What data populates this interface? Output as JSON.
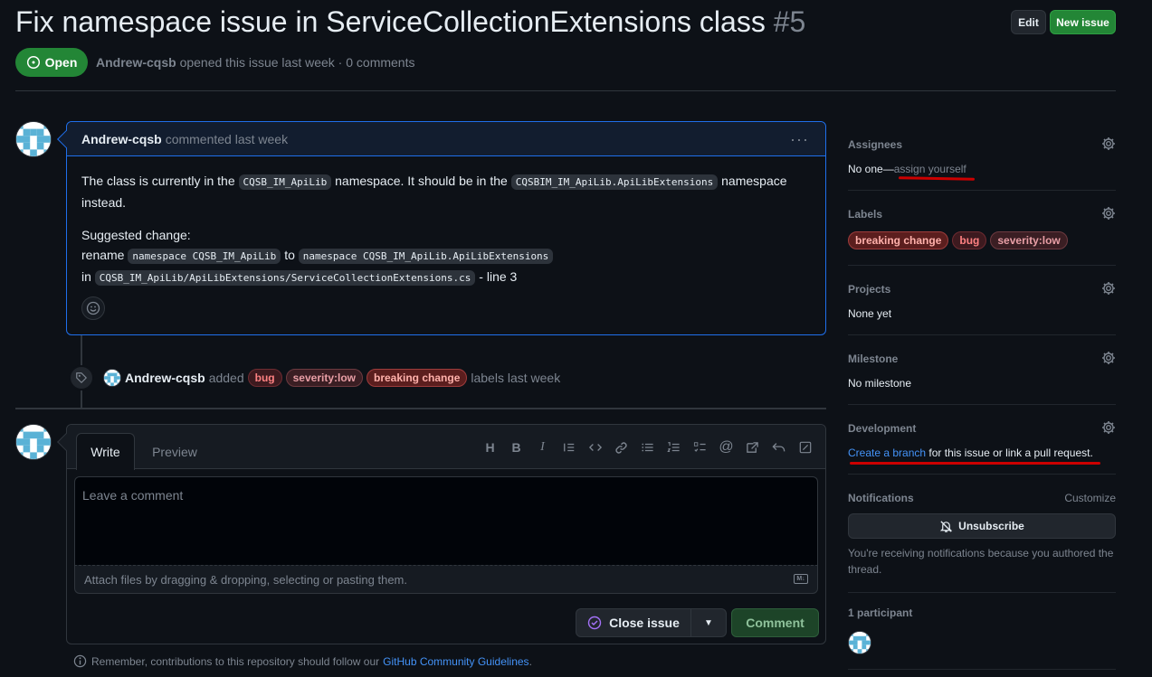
{
  "issue": {
    "title": "Fix namespace issue in ServiceCollectionExtensions class",
    "number": "#5",
    "state": "Open",
    "author": "Andrew-cqsb",
    "meta_text": "opened this issue last week · 0 comments"
  },
  "header": {
    "edit_label": "Edit",
    "new_issue_label": "New issue"
  },
  "comment": {
    "author": "Andrew-cqsb",
    "time_text": "commented last week",
    "menu": "···",
    "p1_a": "The class is currently in the",
    "p1_code1": "CQSB_IM_ApiLib",
    "p1_b": "namespace. It should be in the",
    "p1_code2": "CQSBIM_IM_ApiLib.ApiLibExtensions",
    "p1_c": "namespace instead.",
    "p2_title": "Suggested change:",
    "p2_rename": "rename",
    "p2_code1": "namespace CQSB_IM_ApiLib",
    "p2_to": "to",
    "p2_code2": "namespace CQSB_IM_ApiLib.ApiLibExtensions",
    "p2_in": "in",
    "p2_code3": "CQSB_IM_ApiLib/ApiLibExtensions/ServiceCollectionExtensions.cs",
    "p2_line": "- line 3"
  },
  "event": {
    "author": "Andrew-cqsb",
    "added": "added",
    "labels": [
      "bug",
      "severity:low",
      "breaking change"
    ],
    "suffix": "labels last week"
  },
  "composer": {
    "tab_write": "Write",
    "tab_preview": "Preview",
    "placeholder": "Leave a comment",
    "attach_text": "Attach files by dragging & dropping, selecting or pasting them.",
    "md_badge": "M↓",
    "close_label": "Close issue",
    "comment_label": "Comment",
    "toolbar_icons": [
      "heading-icon",
      "bold-icon",
      "italic-icon",
      "quote-icon",
      "code-icon",
      "link-icon",
      "bulleted-list-icon",
      "numbered-list-icon",
      "task-list-icon",
      "mention-icon",
      "cross-reference-icon",
      "undo-icon",
      "fullscreen-icon"
    ]
  },
  "remember": {
    "text": "Remember, contributions to this repository should follow our",
    "link": "GitHub Community Guidelines",
    "end": "."
  },
  "sidebar": {
    "assignees": {
      "title": "Assignees",
      "value": "No one—",
      "link": "assign yourself"
    },
    "labels": {
      "title": "Labels",
      "items": [
        "breaking change",
        "bug",
        "severity:low"
      ]
    },
    "projects": {
      "title": "Projects",
      "value": "None yet"
    },
    "milestone": {
      "title": "Milestone",
      "value": "No milestone"
    },
    "development": {
      "title": "Development",
      "link": "Create a branch",
      "rest": "for this issue or link a pull request."
    },
    "notifications": {
      "title": "Notifications",
      "customize": "Customize",
      "button": "Unsubscribe",
      "note": "You're receiving notifications because you authored the thread."
    },
    "participants": {
      "title": "1 participant"
    }
  },
  "colors": {
    "accent": "#4493f8",
    "open": "#238636",
    "bg": "#0d1117",
    "annotation": "#cc0000"
  }
}
